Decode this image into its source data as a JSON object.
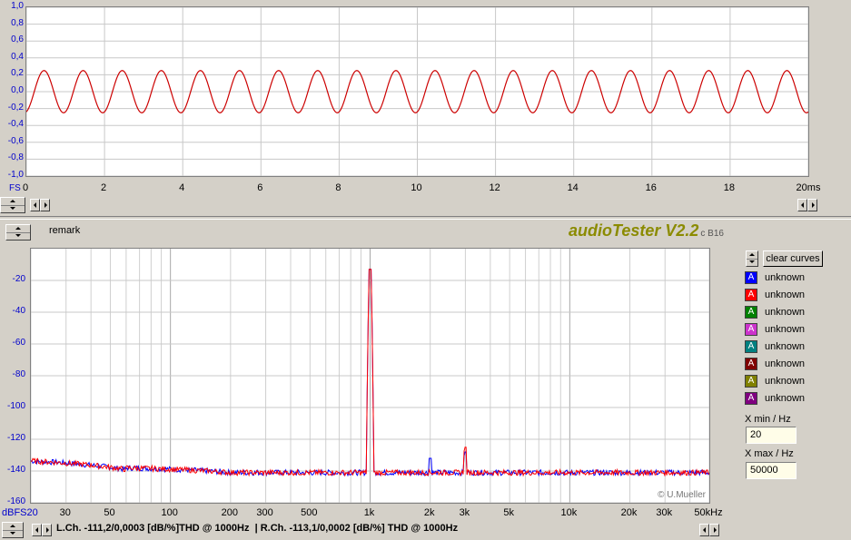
{
  "scope": {
    "y_labels": [
      "1,0",
      "0,8",
      "0,6",
      "0,4",
      "0,2",
      "0,0",
      "-0,2",
      "-0,4",
      "-0,6",
      "-0,8",
      "-1,0"
    ],
    "y_unit": "FS",
    "x_labels": [
      "0",
      "2",
      "4",
      "6",
      "8",
      "10",
      "12",
      "14",
      "16",
      "18",
      "20ms"
    ],
    "signal_color": "#cc0000"
  },
  "header": {
    "remark_label": "remark",
    "app_title": "audioTester V2.2",
    "app_sub": "c B16"
  },
  "spectrum": {
    "y_labels": [
      "-20",
      "-40",
      "-60",
      "-80",
      "-100",
      "-120",
      "-140",
      "-160"
    ],
    "x_labels": [
      "dBFS20",
      "30",
      "50",
      "100",
      "200",
      "300",
      "500",
      "1k",
      "2k",
      "3k",
      "5k",
      "10k",
      "20k",
      "30k",
      "50kHz"
    ],
    "watermark": "© U.Mueller"
  },
  "legend": {
    "clear_label": "clear curves",
    "items": [
      {
        "label": "unknown",
        "color": "#0000ff"
      },
      {
        "label": "unknown",
        "color": "#ff0000"
      },
      {
        "label": "unknown",
        "color": "#008000"
      },
      {
        "label": "unknown",
        "color": "#cc33cc"
      },
      {
        "label": "unknown",
        "color": "#008080"
      },
      {
        "label": "unknown",
        "color": "#800000"
      },
      {
        "label": "unknown",
        "color": "#808000"
      },
      {
        "label": "unknown",
        "color": "#800080"
      }
    ],
    "xmin_label": "X min / Hz",
    "xmin_value": "20",
    "xmax_label": "X max / Hz",
    "xmax_value": "50000"
  },
  "status": {
    "text": "L.Ch. -111,2/0,0003 [dB/%]THD @ 1000Hz  | R.Ch. -113,1/0,0002 [dB/%] THD @ 1000Hz"
  },
  "chart_data": [
    {
      "type": "line",
      "x": [
        0,
        20
      ],
      "xlabel": "ms",
      "ylabel": "FS",
      "ylim": [
        -1.0,
        1.0
      ],
      "xlim": [
        0,
        20
      ],
      "series": [
        {
          "waveform": "sine",
          "frequency_hz": 1000,
          "amplitude": 0.25
        }
      ]
    },
    {
      "type": "line",
      "xlabel": "Hz",
      "ylabel": "dBFS",
      "x_scale": "log",
      "xlim": [
        20,
        50000
      ],
      "ylim": [
        -160,
        0
      ],
      "series": [
        {
          "color": "#0000ff",
          "noise_floor_db": -141,
          "peaks": [
            {
              "x": 1000,
              "y": -13
            },
            {
              "x": 2000,
              "y": -132
            },
            {
              "x": 3000,
              "y": -128
            }
          ]
        },
        {
          "color": "#ff0000",
          "noise_floor_db": -141,
          "peaks": [
            {
              "x": 1000,
              "y": -13
            },
            {
              "x": 3000,
              "y": -125
            }
          ]
        }
      ]
    }
  ]
}
